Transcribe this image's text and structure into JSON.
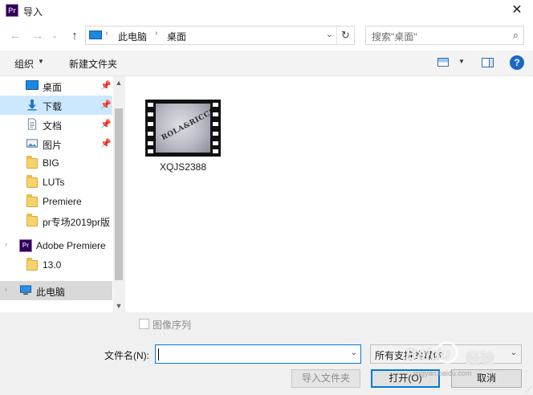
{
  "window": {
    "app_icon_text": "Pr",
    "title": "导入",
    "close_glyph": "✕"
  },
  "nav": {
    "back_glyph": "←",
    "forward_glyph": "→",
    "history_glyph": "⌄",
    "up_glyph": "↑"
  },
  "address": {
    "segments": [
      "此电脑",
      "桌面"
    ],
    "separator": "›",
    "dropdown_glyph": "⌄",
    "refresh_glyph": "↻"
  },
  "search": {
    "placeholder": "搜索\"桌面\"",
    "icon_glyph": "⌕"
  },
  "toolbar": {
    "organize_label": "组织",
    "organize_caret": "▼",
    "new_folder_label": "新建文件夹",
    "view_caret": "▼",
    "help_label": "?"
  },
  "sidebar": {
    "pin_glyph": "📌",
    "expand_glyph": "›",
    "items": [
      {
        "label": "桌面",
        "icon": "desktop-icon",
        "pinned": true
      },
      {
        "label": "下载",
        "icon": "download-icon",
        "pinned": true
      },
      {
        "label": "文档",
        "icon": "document-icon",
        "pinned": true
      },
      {
        "label": "图片",
        "icon": "picture-icon",
        "pinned": true
      },
      {
        "label": "BIG",
        "icon": "folder-icon"
      },
      {
        "label": "LUTs",
        "icon": "folder-icon"
      },
      {
        "label": "Premiere",
        "icon": "folder-icon"
      },
      {
        "label": "pr专场2019pr版",
        "icon": "folder-icon"
      },
      {
        "label": "Adobe Premiere",
        "icon": "premiere-icon"
      },
      {
        "label": "13.0",
        "icon": "folder-icon"
      },
      {
        "label": "此电脑",
        "icon": "computer-icon"
      }
    ],
    "scroll_up": "▲",
    "scroll_down": "▼"
  },
  "content": {
    "files": [
      {
        "name": "XQJS2388",
        "thumb_text": "ROLA&RICCI",
        "type": "video"
      }
    ]
  },
  "bottom": {
    "image_sequence_label": "图像序列",
    "filename_label": "文件名(N):",
    "filename_value": "",
    "filename_dropdown": "⌄",
    "filetype_value": "所有支持的媒体",
    "filetype_dropdown": "⌄",
    "import_folder_label": "导入文件夹",
    "open_label": "打开(O)",
    "cancel_label": "取消",
    "grip_glyph": "⋰"
  },
  "watermark": {
    "brand": "Baidu",
    "text": "经验",
    "url": "jingyan.baidu.com"
  },
  "colors": {
    "accent": "#0078d7",
    "selected_bg": "#cce8ff",
    "hover_bg": "#d9d9d9",
    "help_blue": "#1a67c9",
    "premiere_purple": "#2c0050"
  }
}
